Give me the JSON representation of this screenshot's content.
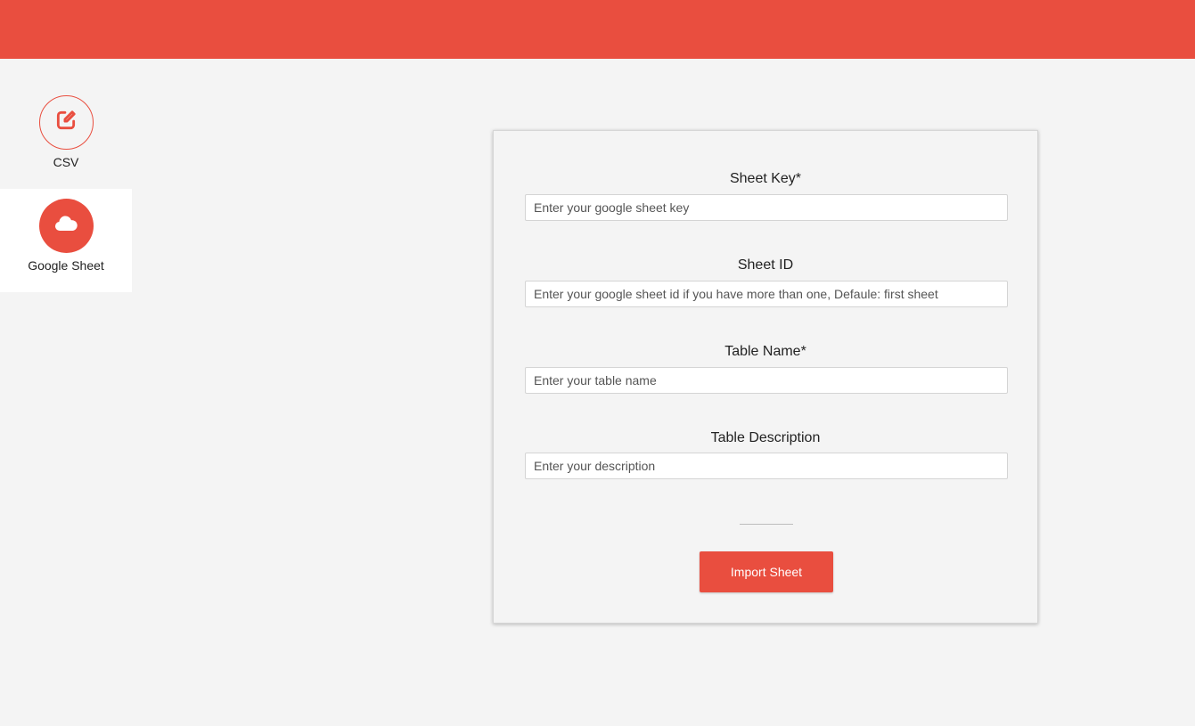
{
  "colors": {
    "accent": "#e94e3f",
    "background": "#f4f4f4",
    "panel_border": "#d6d6d6"
  },
  "sidebar": {
    "items": [
      {
        "label": "CSV",
        "icon": "edit-icon",
        "active": false
      },
      {
        "label": "Google Sheet",
        "icon": "cloud-icon",
        "active": true
      }
    ]
  },
  "form": {
    "fields": [
      {
        "label": "Sheet Key*",
        "placeholder": "Enter your google sheet key",
        "value": ""
      },
      {
        "label": "Sheet ID",
        "placeholder": "Enter your google sheet id if you have more than one, Defaule: first sheet",
        "value": ""
      },
      {
        "label": "Table Name*",
        "placeholder": "Enter your table name",
        "value": ""
      },
      {
        "label": "Table Description",
        "placeholder": "Enter your description",
        "value": ""
      }
    ],
    "submit_label": "Import Sheet"
  }
}
